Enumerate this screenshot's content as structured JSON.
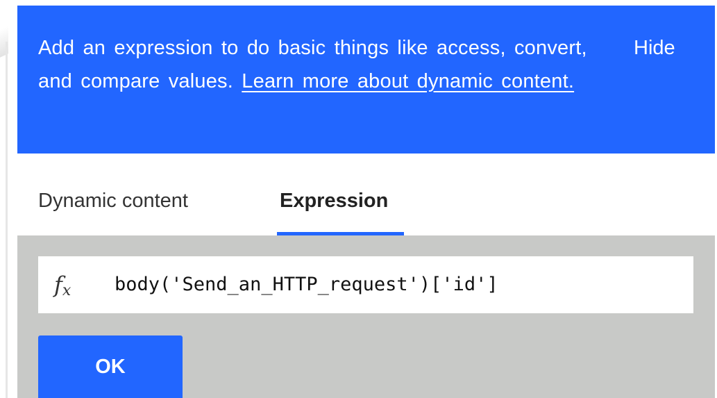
{
  "banner": {
    "text": "Add an expression to do basic things like access, convert, and compare values.",
    "link_text": "Learn more about dynamic content.",
    "hide_label": "Hide"
  },
  "tabs": [
    {
      "label": "Dynamic content",
      "active": false
    },
    {
      "label": "Expression",
      "active": true
    }
  ],
  "expression": {
    "icon": "fx-icon",
    "value": "body('Send_an_HTTP_request')['id']"
  },
  "ok_label": "OK",
  "colors": {
    "accent": "#2266ff",
    "editor_background": "#c8c9c7",
    "white": "#ffffff"
  }
}
